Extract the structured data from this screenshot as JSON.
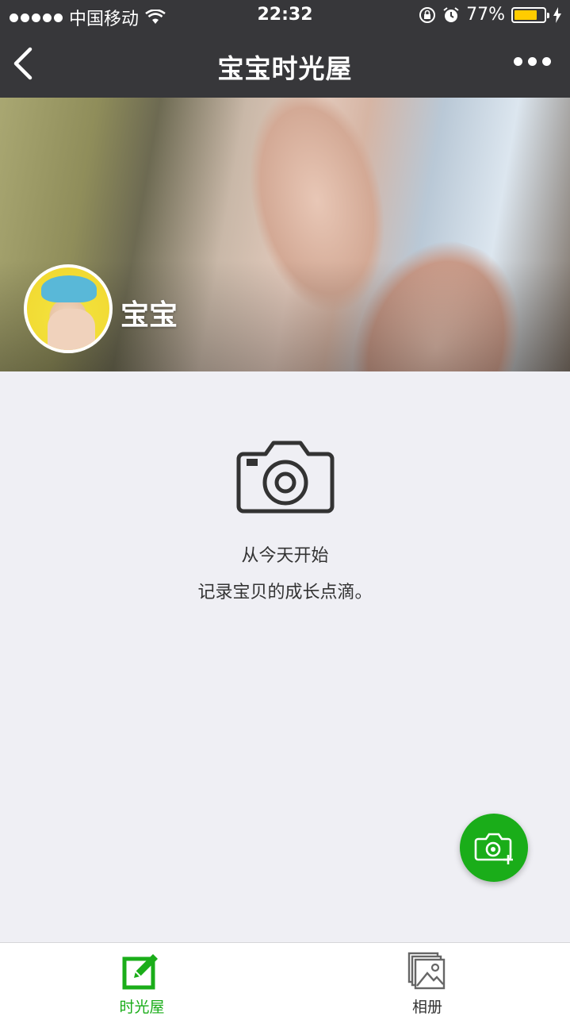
{
  "status_bar": {
    "carrier": "中国移动",
    "time": "22:32",
    "battery_percent": "77%",
    "battery_level": 0.77,
    "icons": [
      "signal-dots-icon",
      "wifi-icon",
      "rotation-lock-icon",
      "alarm-icon",
      "battery-icon",
      "charging-bolt-icon"
    ]
  },
  "navbar": {
    "title": "宝宝时光屋",
    "back_icon": "chevron-left-icon",
    "more_icon": "more-dots-icon"
  },
  "cover": {
    "name": "宝宝"
  },
  "empty_state": {
    "icon": "camera-icon",
    "line1": "从今天开始",
    "line2": "记录宝贝的成长点滴。"
  },
  "fab": {
    "icon": "camera-add-icon"
  },
  "tabbar": {
    "tabs": [
      {
        "label": "时光屋",
        "icon": "edit-icon",
        "active": true
      },
      {
        "label": "相册",
        "icon": "album-icon",
        "active": false
      }
    ]
  },
  "colors": {
    "nav_bg": "#37373a",
    "accent_green": "#1aad19",
    "page_bg": "#efeff4",
    "battery_fill": "#ffcc00"
  }
}
